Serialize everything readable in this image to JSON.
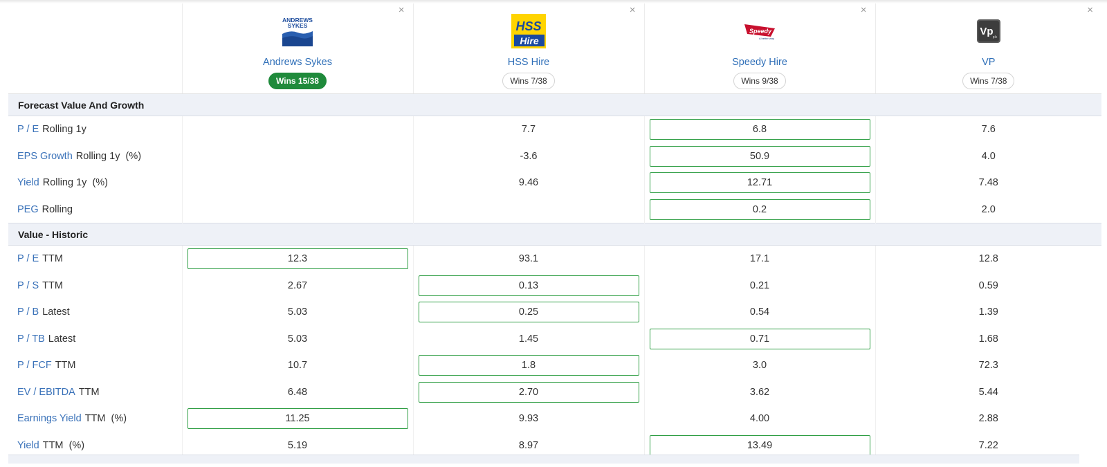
{
  "companies": [
    {
      "name": "Andrews Sykes",
      "wins": "Wins 15/38",
      "leader": true,
      "logo_text": "ANDREWS SYKES"
    },
    {
      "name": "HSS Hire",
      "wins": "Wins 7/38",
      "leader": false,
      "logo_text": "HSS Hire"
    },
    {
      "name": "Speedy Hire",
      "wins": "Wins 9/38",
      "leader": false,
      "logo_text": "Speedy",
      "logo_tagline": "A better way"
    },
    {
      "name": "VP",
      "wins": "Wins 7/38",
      "leader": false,
      "logo_text": "Vp",
      "logo_sub": "plc"
    }
  ],
  "close_symbol": "×",
  "sections": [
    {
      "title": "Forecast Value And Growth",
      "rows": [
        {
          "metric": "P / E",
          "qualifier": "Rolling 1y",
          "values": [
            "",
            "7.7",
            "6.8",
            "7.6"
          ],
          "best": 2
        },
        {
          "metric": "EPS Growth",
          "qualifier": "Rolling 1y  (%)",
          "values": [
            "",
            "-3.6",
            "50.9",
            "4.0"
          ],
          "best": 2
        },
        {
          "metric": "Yield",
          "qualifier": "Rolling 1y  (%)",
          "values": [
            "",
            "9.46",
            "12.71",
            "7.48"
          ],
          "best": 2
        },
        {
          "metric": "PEG",
          "qualifier": "Rolling",
          "values": [
            "",
            "",
            "0.2",
            "2.0"
          ],
          "best": 2
        }
      ]
    },
    {
      "title": "Value - Historic",
      "rows": [
        {
          "metric": "P / E",
          "qualifier": "TTM",
          "values": [
            "12.3",
            "93.1",
            "17.1",
            "12.8"
          ],
          "best": 0
        },
        {
          "metric": "P / S",
          "qualifier": "TTM",
          "values": [
            "2.67",
            "0.13",
            "0.21",
            "0.59"
          ],
          "best": 1
        },
        {
          "metric": "P / B",
          "qualifier": "Latest",
          "values": [
            "5.03",
            "0.25",
            "0.54",
            "1.39"
          ],
          "best": 1
        },
        {
          "metric": "P / TB",
          "qualifier": "Latest",
          "values": [
            "5.03",
            "1.45",
            "0.71",
            "1.68"
          ],
          "best": 2
        },
        {
          "metric": "P / FCF",
          "qualifier": "TTM",
          "values": [
            "10.7",
            "1.8",
            "3.0",
            "72.3"
          ],
          "best": 1
        },
        {
          "metric": "EV / EBITDA",
          "qualifier": "TTM",
          "values": [
            "6.48",
            "2.70",
            "3.62",
            "5.44"
          ],
          "best": 1
        },
        {
          "metric": "Earnings Yield",
          "qualifier": "TTM  (%)",
          "values": [
            "11.25",
            "9.93",
            "4.00",
            "2.88"
          ],
          "best": 0
        },
        {
          "metric": "Yield",
          "qualifier": "TTM  (%)",
          "values": [
            "5.19",
            "8.97",
            "13.49",
            "7.22"
          ],
          "best": 2
        }
      ]
    }
  ],
  "colors": {
    "link": "#2f6fb8",
    "leader_badge": "#1f8a3b",
    "best_border": "#2f9e44",
    "section_bg": "#eef1f7"
  }
}
